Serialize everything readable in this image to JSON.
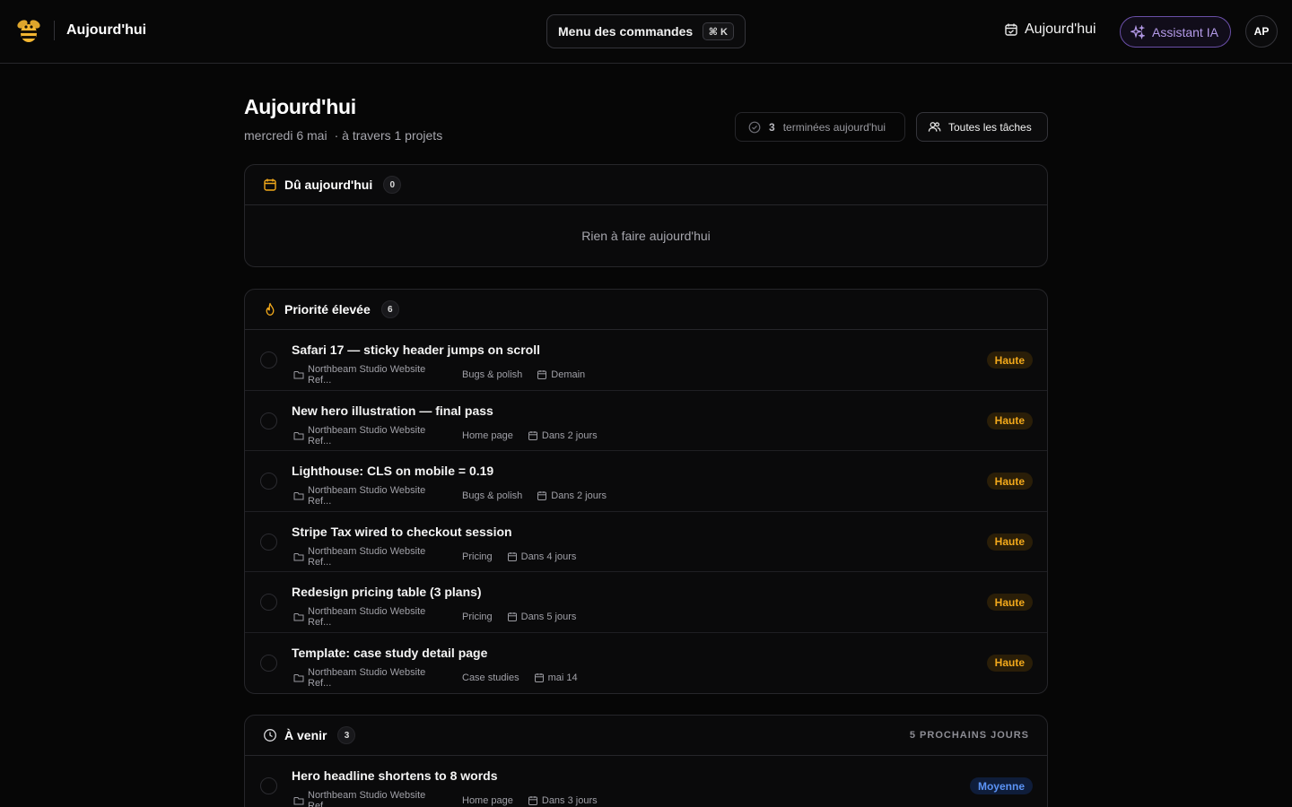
{
  "topbar": {
    "brand_title": "Aujourd'hui",
    "command_menu_label": "Menu des commandes",
    "command_shortcut": "⌘ K",
    "today_label": "Aujourd'hui",
    "assistant_label": "Assistant IA",
    "avatar_initials": "AP"
  },
  "header": {
    "title": "Aujourd'hui",
    "date": "mercredi 6 mai",
    "projects": "· à travers 1 projets",
    "done_count": "3",
    "done_label": "terminées aujourd'hui",
    "all_tasks_label": "Toutes les tâches"
  },
  "due_today": {
    "title": "Dû aujourd'hui",
    "count": "0",
    "empty_text": "Rien à faire aujourd'hui"
  },
  "high_priority": {
    "title": "Priorité élevée",
    "count": "6",
    "tasks": [
      {
        "title": "Safari 17 — sticky header jumps on scroll",
        "project": "Northbeam Studio Website Ref...",
        "section": "Bugs & polish",
        "due": "Demain",
        "priority": "Haute"
      },
      {
        "title": "New hero illustration — final pass",
        "project": "Northbeam Studio Website Ref...",
        "section": "Home page",
        "due": "Dans 2 jours",
        "priority": "Haute"
      },
      {
        "title": "Lighthouse: CLS on mobile = 0.19",
        "project": "Northbeam Studio Website Ref...",
        "section": "Bugs & polish",
        "due": "Dans 2 jours",
        "priority": "Haute"
      },
      {
        "title": "Stripe Tax wired to checkout session",
        "project": "Northbeam Studio Website Ref...",
        "section": "Pricing",
        "due": "Dans 4 jours",
        "priority": "Haute"
      },
      {
        "title": "Redesign pricing table (3 plans)",
        "project": "Northbeam Studio Website Ref...",
        "section": "Pricing",
        "due": "Dans 5 jours",
        "priority": "Haute"
      },
      {
        "title": "Template: case study detail page",
        "project": "Northbeam Studio Website Ref...",
        "section": "Case studies",
        "due": "mai 14",
        "priority": "Haute"
      }
    ]
  },
  "upcoming": {
    "title": "À venir",
    "count": "3",
    "range_label": "5 PROCHAINS JOURS",
    "tasks": [
      {
        "title": "Hero headline shortens to 8 words",
        "project": "Northbeam Studio Website Ref...",
        "section": "Home page",
        "due": "Dans 3 jours",
        "priority": "Moyenne"
      }
    ]
  },
  "colors": {
    "accent_ai": "#b49ae8",
    "priority_high": "#f3a91b",
    "priority_medium": "#5b93f5",
    "due_icon": "#f3a91b"
  }
}
